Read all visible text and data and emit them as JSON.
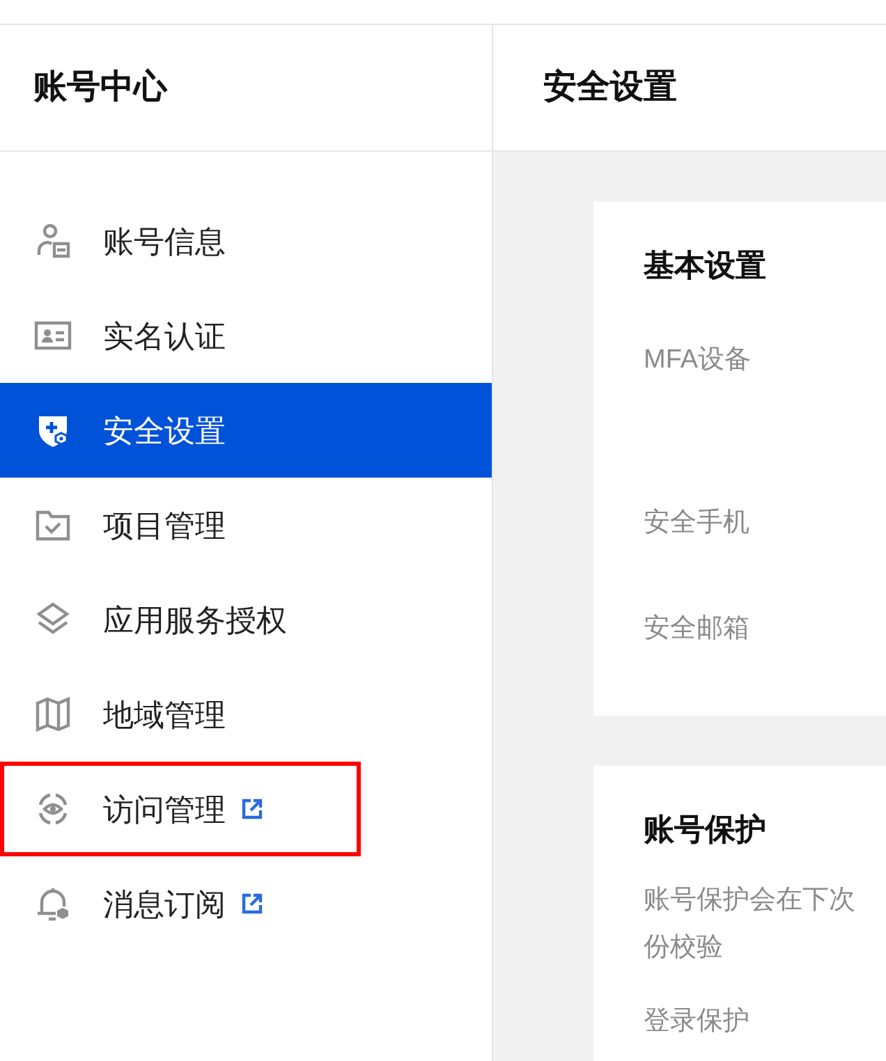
{
  "sidebar": {
    "title": "账号中心",
    "items": [
      {
        "label": "账号信息",
        "kind": "user",
        "selected": false,
        "external": false,
        "highlighted": false
      },
      {
        "label": "实名认证",
        "kind": "idcard",
        "selected": false,
        "external": false,
        "highlighted": false
      },
      {
        "label": "安全设置",
        "kind": "shield",
        "selected": true,
        "external": false,
        "highlighted": false
      },
      {
        "label": "项目管理",
        "kind": "folder",
        "selected": false,
        "external": false,
        "highlighted": false
      },
      {
        "label": "应用服务授权",
        "kind": "layers",
        "selected": false,
        "external": false,
        "highlighted": false
      },
      {
        "label": "地域管理",
        "kind": "map",
        "selected": false,
        "external": false,
        "highlighted": false
      },
      {
        "label": "访问管理",
        "kind": "target",
        "selected": false,
        "external": true,
        "highlighted": true
      },
      {
        "label": "消息订阅",
        "kind": "bell",
        "selected": false,
        "external": true,
        "highlighted": false
      }
    ]
  },
  "main": {
    "title": "安全设置",
    "cards": [
      {
        "title": "基本设置",
        "rows": [
          {
            "label": "MFA设备",
            "tall": true
          },
          {
            "label": "安全手机",
            "tall": false
          },
          {
            "label": "安全邮箱",
            "tall": false
          }
        ]
      },
      {
        "title": "账号保护",
        "description": [
          "账号保护会在下次",
          "份校验"
        ],
        "rows": [
          {
            "label": "登录保护",
            "tall": false
          }
        ]
      }
    ]
  }
}
